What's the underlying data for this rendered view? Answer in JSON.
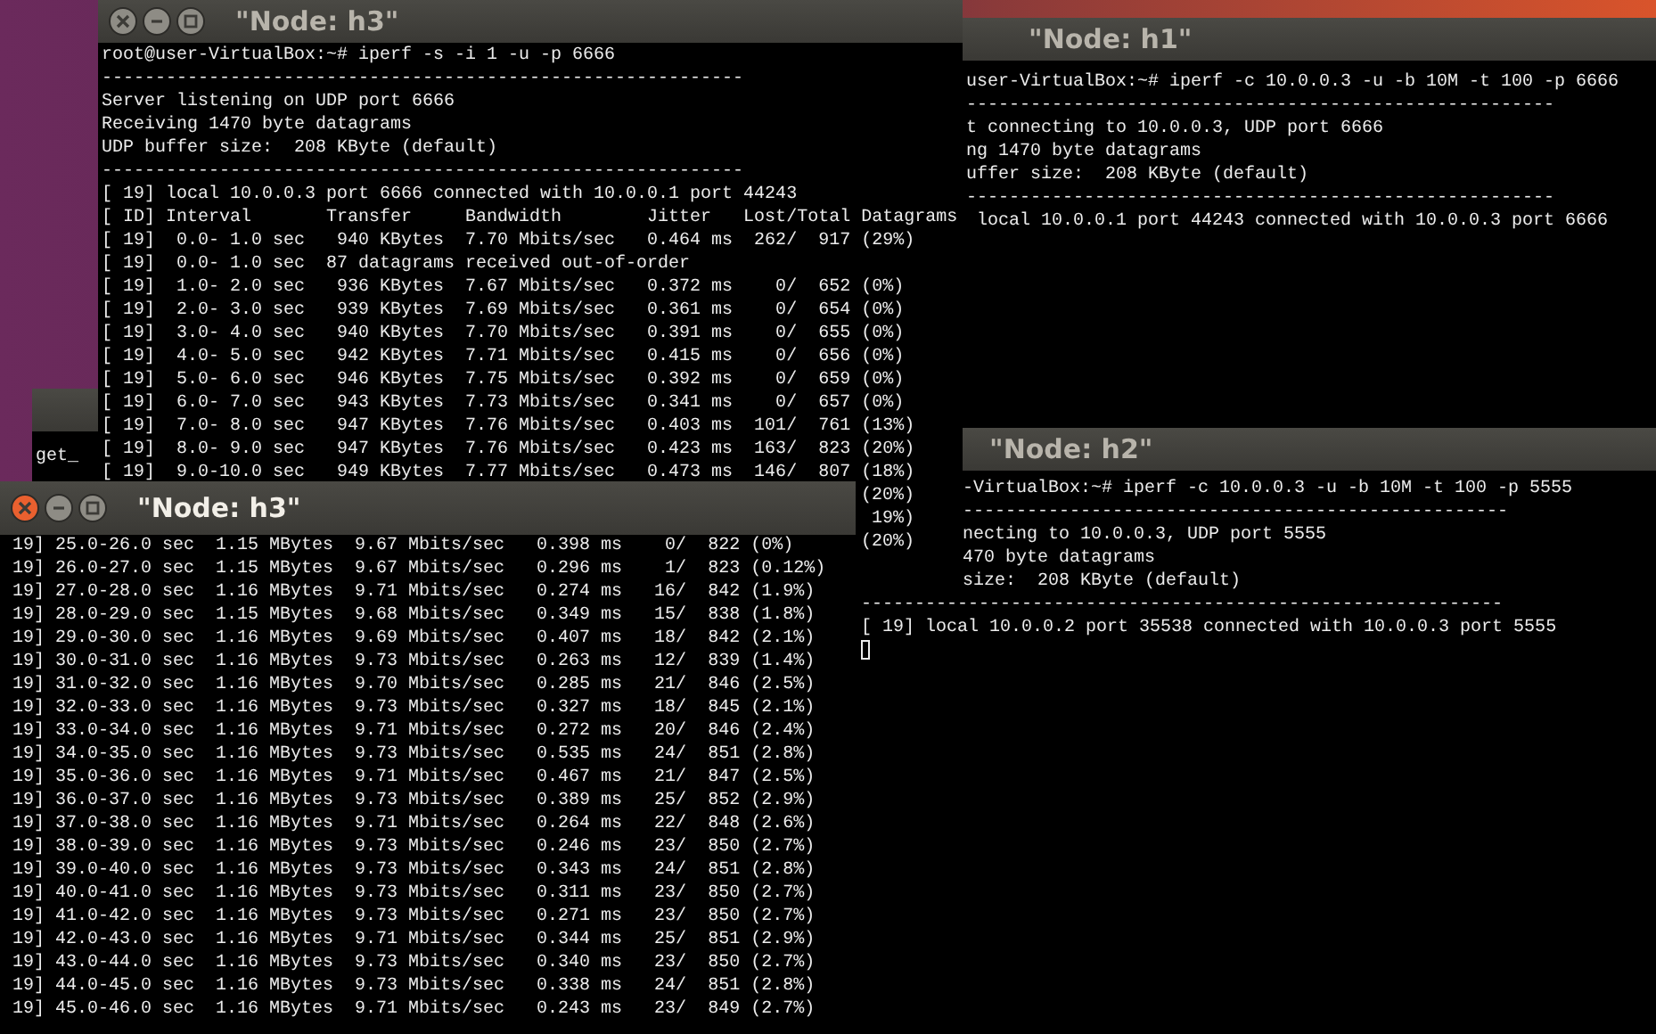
{
  "windows": [
    {
      "title": "\"Node: h3\"",
      "active": false,
      "lines": [
        {
          "kind": "full",
          "text": "root@user-VirtualBox:~# iperf -s -i 1 -u -p 6666"
        },
        {
          "kind": "full",
          "text": "------------------------------------------------------------"
        },
        {
          "kind": "full",
          "text": "Server listening on UDP port 6666"
        },
        {
          "kind": "full",
          "text": "Receiving 1470 byte datagrams"
        },
        {
          "kind": "full",
          "text": "UDP buffer size:  208 KByte (default)"
        },
        {
          "kind": "full",
          "text": "------------------------------------------------------------"
        },
        {
          "kind": "full",
          "text": "[ 19] local 10.0.0.3 port 6666 connected with 10.0.0.1 port 44243"
        },
        {
          "kind": "full",
          "text": "[ ID] Interval       Transfer     Bandwidth        Jitter   Lost/Total Datagrams"
        },
        {
          "kind": "full",
          "text": "[ 19]  0.0- 1.0 sec   940 KBytes  7.70 Mbits/sec   0.464 ms  262/  917 (29%)"
        },
        {
          "kind": "full",
          "text": "[ 19]  0.0- 1.0 sec  87 datagrams received out-of-order"
        },
        {
          "kind": "full",
          "text": "[ 19]  1.0- 2.0 sec   936 KBytes  7.67 Mbits/sec   0.372 ms    0/  652 (0%)"
        },
        {
          "kind": "full",
          "text": "[ 19]  2.0- 3.0 sec   939 KBytes  7.69 Mbits/sec   0.361 ms    0/  654 (0%)"
        },
        {
          "kind": "full",
          "text": "[ 19]  3.0- 4.0 sec   940 KBytes  7.70 Mbits/sec   0.391 ms    0/  655 (0%)"
        },
        {
          "kind": "full",
          "text": "[ 19]  4.0- 5.0 sec   942 KBytes  7.71 Mbits/sec   0.415 ms    0/  656 (0%)"
        },
        {
          "kind": "full",
          "text": "[ 19]  5.0- 6.0 sec   946 KBytes  7.75 Mbits/sec   0.392 ms    0/  659 (0%)"
        },
        {
          "kind": "full",
          "text": "[ 19]  6.0- 7.0 sec   943 KBytes  7.73 Mbits/sec   0.341 ms    0/  657 (0%)"
        },
        {
          "kind": "full",
          "text": "[ 19]  7.0- 8.0 sec   947 KBytes  7.76 Mbits/sec   0.403 ms  101/  761 (13%)"
        },
        {
          "kind": "full",
          "text": "[ 19]  8.0- 9.0 sec   947 KBytes  7.76 Mbits/sec   0.423 ms  163/  823 (20%)"
        },
        {
          "kind": "full",
          "text": "[ 19]  9.0-10.0 sec   949 KBytes  7.77 Mbits/sec   0.473 ms  146/  807 (18%)"
        },
        {
          "kind": "tail",
          "text": "(20%)"
        },
        {
          "kind": "tail",
          "text": "19%)"
        },
        {
          "kind": "tail",
          "text": "(20%)"
        }
      ]
    },
    {
      "title": "\"Node: h1\"",
      "lines": [
        {
          "kind": "full",
          "text": "user-VirtualBox:~# iperf -c 10.0.0.3 -u -b 10M -t 100 -p 6666"
        },
        {
          "kind": "full",
          "text": "-------------------------------------------------------"
        },
        {
          "kind": "full",
          "text": "t connecting to 10.0.0.3, UDP port 6666"
        },
        {
          "kind": "full",
          "text": "ng 1470 byte datagrams"
        },
        {
          "kind": "full",
          "text": "uffer size:  208 KByte (default)"
        },
        {
          "kind": "full",
          "text": "-------------------------------------------------------"
        },
        {
          "kind": "full",
          "text": " local 10.0.0.1 port 44243 connected with 10.0.0.3 port 6666"
        }
      ]
    },
    {
      "title": "\"Node: h2\"",
      "lines": [
        {
          "kind": "cut",
          "text": "-VirtualBox:~# iperf -c 10.0.0.3 -u -b 10M -t 100 -p 5555"
        },
        {
          "kind": "cut",
          "text": "---------------------------------------------------"
        },
        {
          "kind": "cut",
          "text": "necting to 10.0.0.3, UDP port 5555"
        },
        {
          "kind": "cut",
          "text": "470 byte datagrams"
        },
        {
          "kind": "cut",
          "text": "size:  208 KByte (default)"
        },
        {
          "kind": "full",
          "text": "------------------------------------------------------------"
        },
        {
          "kind": "full",
          "text": "[ 19] local 10.0.0.2 port 35538 connected with 10.0.0.3 port 5555"
        }
      ]
    },
    {
      "title": "\"Node: h3\"",
      "active": true,
      "lines": [
        {
          "kind": "full",
          "text": "19] 25.0-26.0 sec  1.15 MBytes  9.67 Mbits/sec   0.398 ms    0/  822 (0%)"
        },
        {
          "kind": "full",
          "text": "19] 26.0-27.0 sec  1.15 MBytes  9.67 Mbits/sec   0.296 ms    1/  823 (0.12%)"
        },
        {
          "kind": "full",
          "text": "19] 27.0-28.0 sec  1.16 MBytes  9.71 Mbits/sec   0.274 ms   16/  842 (1.9%)"
        },
        {
          "kind": "full",
          "text": "19] 28.0-29.0 sec  1.15 MBytes  9.68 Mbits/sec   0.349 ms   15/  838 (1.8%)"
        },
        {
          "kind": "full",
          "text": "19] 29.0-30.0 sec  1.16 MBytes  9.69 Mbits/sec   0.407 ms   18/  842 (2.1%)"
        },
        {
          "kind": "full",
          "text": "19] 30.0-31.0 sec  1.16 MBytes  9.73 Mbits/sec   0.263 ms   12/  839 (1.4%)"
        },
        {
          "kind": "full",
          "text": "19] 31.0-32.0 sec  1.16 MBytes  9.70 Mbits/sec   0.285 ms   21/  846 (2.5%)"
        },
        {
          "kind": "full",
          "text": "19] 32.0-33.0 sec  1.16 MBytes  9.73 Mbits/sec   0.327 ms   18/  845 (2.1%)"
        },
        {
          "kind": "full",
          "text": "19] 33.0-34.0 sec  1.16 MBytes  9.71 Mbits/sec   0.272 ms   20/  846 (2.4%)"
        },
        {
          "kind": "full",
          "text": "19] 34.0-35.0 sec  1.16 MBytes  9.73 Mbits/sec   0.535 ms   24/  851 (2.8%)"
        },
        {
          "kind": "full",
          "text": "19] 35.0-36.0 sec  1.16 MBytes  9.71 Mbits/sec   0.467 ms   21/  847 (2.5%)"
        },
        {
          "kind": "full",
          "text": "19] 36.0-37.0 sec  1.16 MBytes  9.73 Mbits/sec   0.389 ms   25/  852 (2.9%)"
        },
        {
          "kind": "full",
          "text": "19] 37.0-38.0 sec  1.16 MBytes  9.71 Mbits/sec   0.264 ms   22/  848 (2.6%)"
        },
        {
          "kind": "full",
          "text": "19] 38.0-39.0 sec  1.16 MBytes  9.73 Mbits/sec   0.246 ms   23/  850 (2.7%)"
        },
        {
          "kind": "full",
          "text": "19] 39.0-40.0 sec  1.16 MBytes  9.73 Mbits/sec   0.343 ms   24/  851 (2.8%)"
        },
        {
          "kind": "full",
          "text": "19] 40.0-41.0 sec  1.16 MBytes  9.73 Mbits/sec   0.311 ms   23/  850 (2.7%)"
        },
        {
          "kind": "full",
          "text": "19] 41.0-42.0 sec  1.16 MBytes  9.73 Mbits/sec   0.271 ms   23/  850 (2.7%)"
        },
        {
          "kind": "full",
          "text": "19] 42.0-43.0 sec  1.16 MBytes  9.71 Mbits/sec   0.344 ms   25/  851 (2.9%)"
        },
        {
          "kind": "full",
          "text": "19] 43.0-44.0 sec  1.16 MBytes  9.73 Mbits/sec   0.340 ms   23/  850 (2.7%)"
        },
        {
          "kind": "full",
          "text": "19] 44.0-45.0 sec  1.16 MBytes  9.73 Mbits/sec   0.338 ms   24/  851 (2.8%)"
        },
        {
          "kind": "full",
          "text": "19] 45.0-46.0 sec  1.16 MBytes  9.71 Mbits/sec   0.243 ms   23/  849 (2.7%)"
        }
      ]
    },
    {
      "lines": [
        {
          "kind": "full",
          "text": "get_"
        }
      ]
    }
  ]
}
